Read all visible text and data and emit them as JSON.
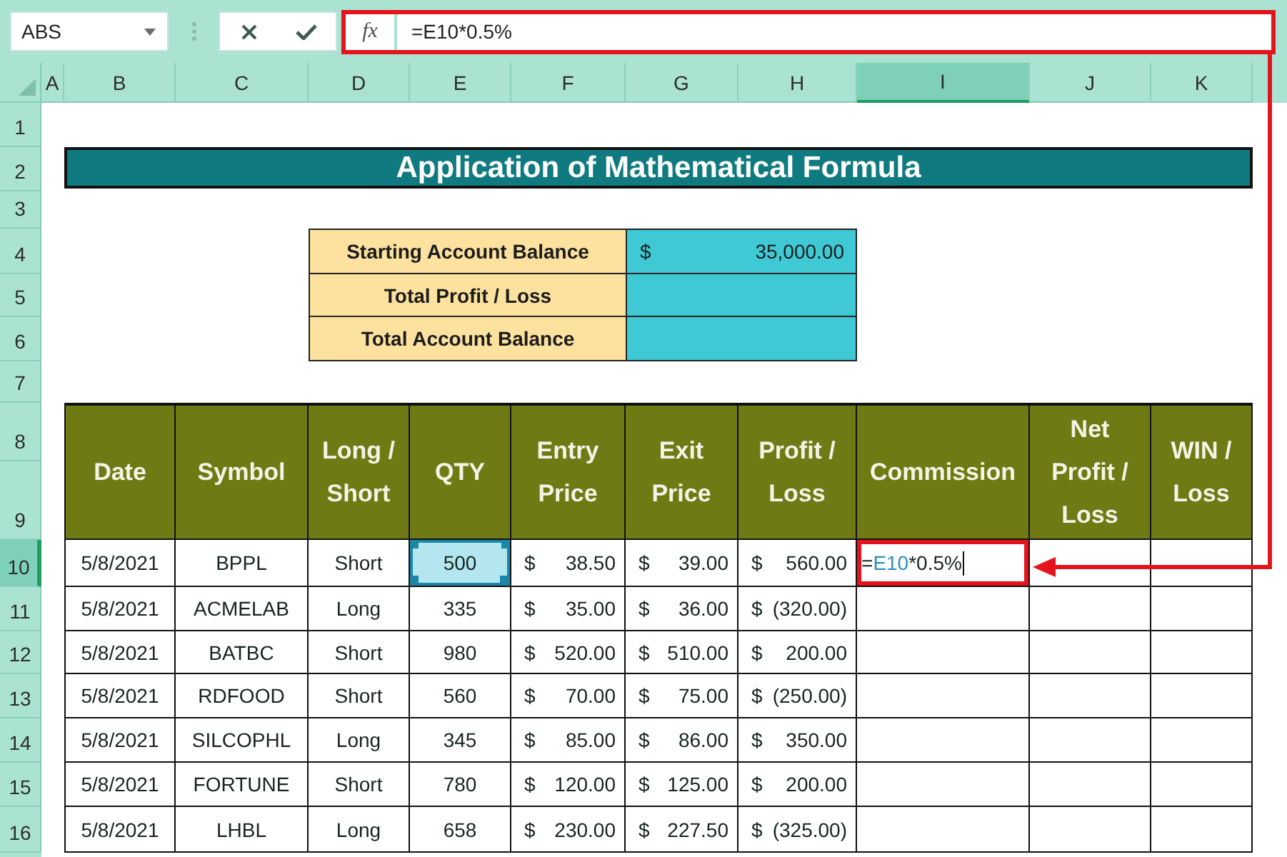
{
  "name_box": {
    "value": "ABS"
  },
  "formula_bar": {
    "function_label": "fx",
    "formula": "=E10*0.5%",
    "highlighted": true
  },
  "columns": [
    {
      "label": "A",
      "selected": false
    },
    {
      "label": "B",
      "selected": false
    },
    {
      "label": "C",
      "selected": false
    },
    {
      "label": "D",
      "selected": false
    },
    {
      "label": "E",
      "selected": false
    },
    {
      "label": "F",
      "selected": false
    },
    {
      "label": "G",
      "selected": false
    },
    {
      "label": "H",
      "selected": false
    },
    {
      "label": "I",
      "selected": true
    },
    {
      "label": "J",
      "selected": false
    },
    {
      "label": "K",
      "selected": false
    }
  ],
  "rows": [
    {
      "label": "1",
      "selected": false
    },
    {
      "label": "2",
      "selected": false
    },
    {
      "label": "3",
      "selected": false
    },
    {
      "label": "4",
      "selected": false
    },
    {
      "label": "5",
      "selected": false
    },
    {
      "label": "6",
      "selected": false
    },
    {
      "label": "7",
      "selected": false
    },
    {
      "label": "8",
      "selected": false
    },
    {
      "label": "9",
      "selected": false
    },
    {
      "label": "10",
      "selected": true
    },
    {
      "label": "11",
      "selected": false
    },
    {
      "label": "12",
      "selected": false
    },
    {
      "label": "13",
      "selected": false
    },
    {
      "label": "14",
      "selected": false
    },
    {
      "label": "15",
      "selected": false
    },
    {
      "label": "16",
      "selected": false
    }
  ],
  "title": "Application of Mathematical Formula",
  "summary": [
    {
      "label": "Starting Account Balance",
      "currency": "$",
      "amount": "35,000.00"
    },
    {
      "label": "Total Profit / Loss"
    },
    {
      "label": "Total Account Balance"
    }
  ],
  "trades": {
    "columns": [
      "Date",
      "Symbol",
      "Long / Short",
      "QTY",
      "Entry Price",
      "Exit Price",
      "Profit / Loss",
      "Commission",
      "Net Profit / Loss",
      "WIN / Loss"
    ],
    "rows": [
      {
        "date": "5/8/2021",
        "symbol": "BPPL",
        "position": "Short",
        "qty": {
          "value": "500",
          "referenced": true
        },
        "entry_price": {
          "currency": "$",
          "amount": "38.50"
        },
        "exit_price": {
          "currency": "$",
          "amount": "39.00"
        },
        "profit_loss": {
          "currency": "$",
          "amount": "560.00"
        },
        "commission": {
          "formula": [
            {
              "kind": "operator",
              "text": "="
            },
            {
              "kind": "reference",
              "text": "E10"
            },
            {
              "kind": "operator",
              "text": "*0.5%"
            }
          ],
          "editing": true,
          "highlighted": true
        }
      },
      {
        "date": "5/8/2021",
        "symbol": "ACMELAB",
        "position": "Long",
        "qty": {
          "value": "335",
          "referenced": false
        },
        "entry_price": {
          "currency": "$",
          "amount": "35.00"
        },
        "exit_price": {
          "currency": "$",
          "amount": "36.00"
        },
        "profit_loss": {
          "currency": "$",
          "amount": "(320.00)"
        }
      },
      {
        "date": "5/8/2021",
        "symbol": "BATBC",
        "position": "Short",
        "qty": {
          "value": "980",
          "referenced": false
        },
        "entry_price": {
          "currency": "$",
          "amount": "520.00"
        },
        "exit_price": {
          "currency": "$",
          "amount": "510.00"
        },
        "profit_loss": {
          "currency": "$",
          "amount": "200.00"
        }
      },
      {
        "date": "5/8/2021",
        "symbol": "RDFOOD",
        "position": "Short",
        "qty": {
          "value": "560",
          "referenced": false
        },
        "entry_price": {
          "currency": "$",
          "amount": "70.00"
        },
        "exit_price": {
          "currency": "$",
          "amount": "75.00"
        },
        "profit_loss": {
          "currency": "$",
          "amount": "(250.00)"
        }
      },
      {
        "date": "5/8/2021",
        "symbol": "SILCOPHL",
        "position": "Long",
        "qty": {
          "value": "345",
          "referenced": false
        },
        "entry_price": {
          "currency": "$",
          "amount": "85.00"
        },
        "exit_price": {
          "currency": "$",
          "amount": "86.00"
        },
        "profit_loss": {
          "currency": "$",
          "amount": "350.00"
        }
      },
      {
        "date": "5/8/2021",
        "symbol": "FORTUNE",
        "position": "Short",
        "qty": {
          "value": "780",
          "referenced": false
        },
        "entry_price": {
          "currency": "$",
          "amount": "120.00"
        },
        "exit_price": {
          "currency": "$",
          "amount": "125.00"
        },
        "profit_loss": {
          "currency": "$",
          "amount": "200.00"
        }
      },
      {
        "date": "5/8/2021",
        "symbol": "LHBL",
        "position": "Long",
        "qty": {
          "value": "658",
          "referenced": false
        },
        "entry_price": {
          "currency": "$",
          "amount": "230.00"
        },
        "exit_price": {
          "currency": "$",
          "amount": "227.50"
        },
        "profit_loss": {
          "currency": "$",
          "amount": "(325.00)"
        }
      }
    ]
  },
  "callout_arrow": true
}
